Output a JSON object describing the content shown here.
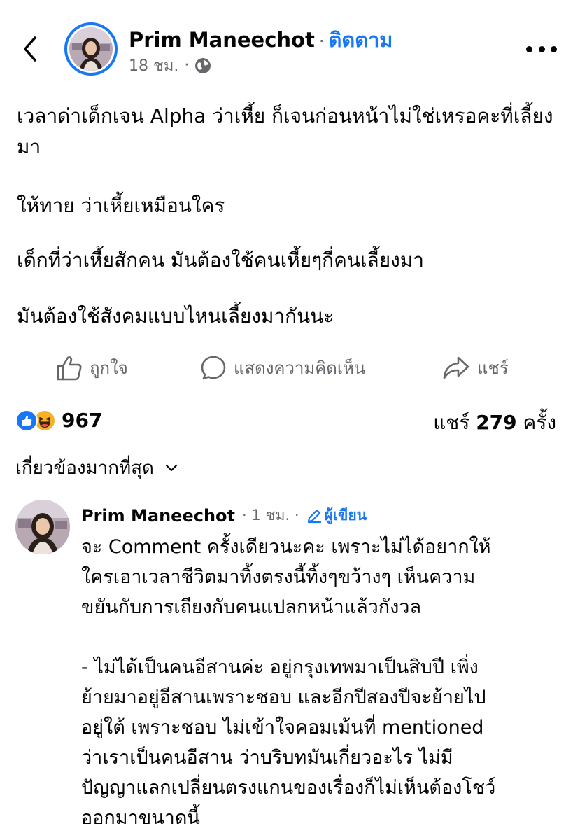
{
  "post": {
    "author": "Prim Maneechot",
    "follow_label": "ติดตาม",
    "time": "18 ชม.",
    "paragraphs": [
      "เวลาด่าเด็กเจน Alpha ว่าเหี้ย ก็เจนก่อนหน้าไม่ใช่เหรอคะที่เลี้ยงมา",
      "ให้ทาย ว่าเหี้ยเหมือนใคร",
      "เด็กที่ว่าเหี้ยสักคน มันต้องใช้คนเหี้ยๆกี่คนเลี้ยงมา",
      "มันต้องใช้สังคมแบบไหนเลี้ยงมากันนะ"
    ]
  },
  "actions": {
    "like": "ถูกใจ",
    "comment": "แสดงความคิดเห็น",
    "share": "แชร์"
  },
  "stats": {
    "reaction_count": "967",
    "share_prefix": "แชร์",
    "share_count": "279",
    "share_suffix": "ครั้ง"
  },
  "sort_label": "เกี่ยวข้องมากที่สุด",
  "comment": {
    "author": "Prim Maneechot",
    "time": "1 ชม.",
    "author_badge": "ผู้เขียน",
    "lines": [
      "จะ Comment ครั้งเดียวนะคะ เพราะไม่ได้อยากให้",
      "ใครเอาเวลาชีวิตมาทิ้งตรงนี้ทิ้งๆขว้างๆ เห็นความ",
      "ขยันกับการเถียงกับคนแปลกหน้าแล้วกังวล",
      "",
      "- ไม่ได้เป็นคนอีสานค่ะ อยู่กรุงเทพมาเป็นสิบปี เพิ่ง",
      "ย้ายมาอยู่อีสานเพราะชอบ และอีกปีสองปีจะย้ายไป",
      "อยู่ใต้ เพราะชอบ ไม่เข้าใจคอมเม้นที่ mentioned",
      "ว่าเราเป็นคนอีสาน ว่าบริบทมันเกี่ยวอะไร ไม่มี",
      "ปัญญาแลกเปลี่ยนตรงแกนของเรื่องก็ไม่เห็นต้องโชว์",
      "ออกมาขนาดนี้"
    ]
  },
  "colors": {
    "accent": "#1877f2",
    "secondary_text": "#65676b",
    "text": "#050505",
    "haha": "#f7b125"
  },
  "icons": [
    "back-arrow-icon",
    "globe-icon",
    "more-icon",
    "like-icon",
    "comment-icon",
    "share-icon",
    "like-reaction-icon",
    "haha-reaction-icon",
    "chevron-down-icon",
    "pencil-icon"
  ]
}
